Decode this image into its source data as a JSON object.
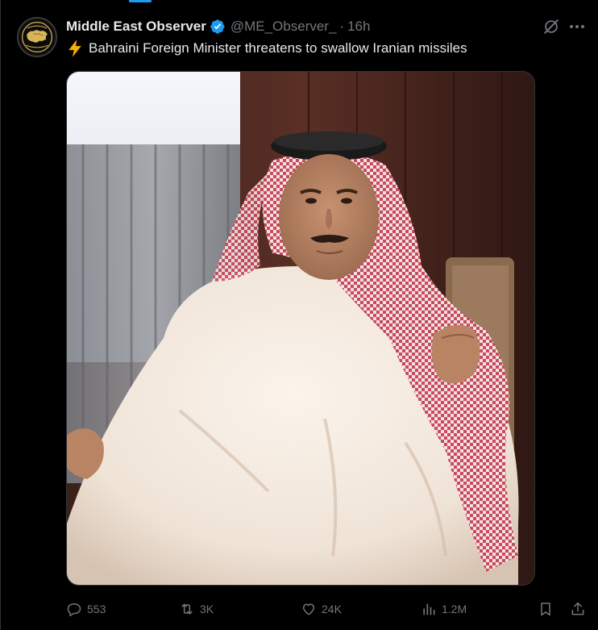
{
  "author": {
    "name": "Middle East Observer",
    "handle": "@ME_Observer_",
    "separator": "·",
    "time": "16h",
    "avatar_icon": "map-logo-icon",
    "verified_icon": "verified-badge-icon"
  },
  "tweet": {
    "text": "Bahraini Foreign Minister threatens to swallow Iranian missiles",
    "emoji_icon": "lightning-bolt-icon"
  },
  "actions": {
    "replies": "553",
    "reposts": "3K",
    "likes": "24K",
    "views": "1.2M"
  },
  "colors": {
    "background": "#000000",
    "text_primary": "#e7e9ea",
    "text_secondary": "#71767b",
    "accent": "#1d9bf0",
    "border": "#2f3336"
  }
}
